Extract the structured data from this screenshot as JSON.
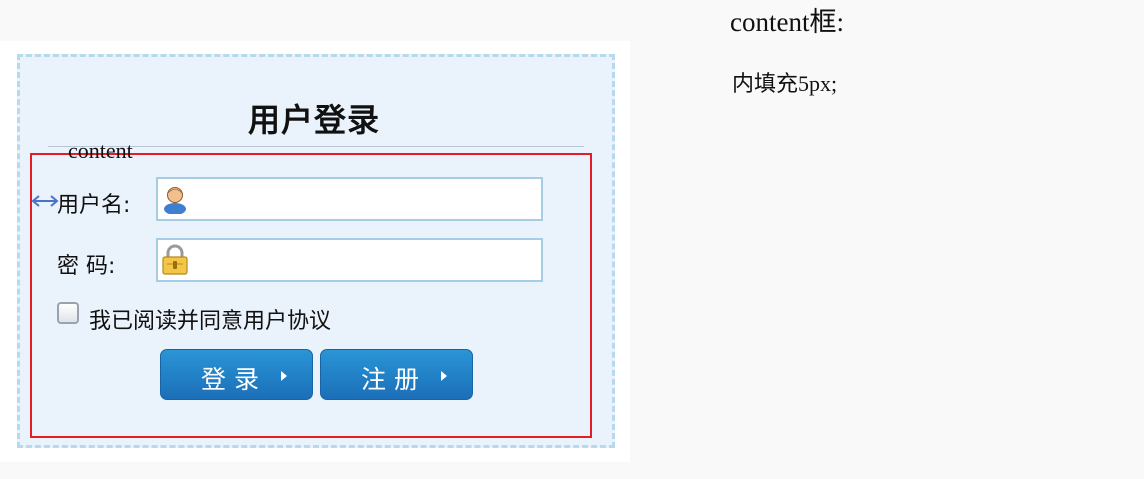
{
  "login": {
    "title": "用户登录",
    "username_label": "用户名:",
    "username_value": "",
    "username_icon": "user-icon",
    "password_label": "密 码:",
    "password_value": "",
    "password_icon": "lock-icon",
    "agree_label": "我已阅读并同意用户协议",
    "agree_checked": false,
    "login_button": "登录",
    "register_button": "注册"
  },
  "annotation": {
    "content_label": "content",
    "side_title": "content框:",
    "side_note": "内填充5px;"
  },
  "colors": {
    "content_border": "#e41c24",
    "box_border": "#b7d9ee",
    "box_background": "#eaf2fb",
    "button": "#2283c7",
    "arrow": "#4a72c8"
  }
}
